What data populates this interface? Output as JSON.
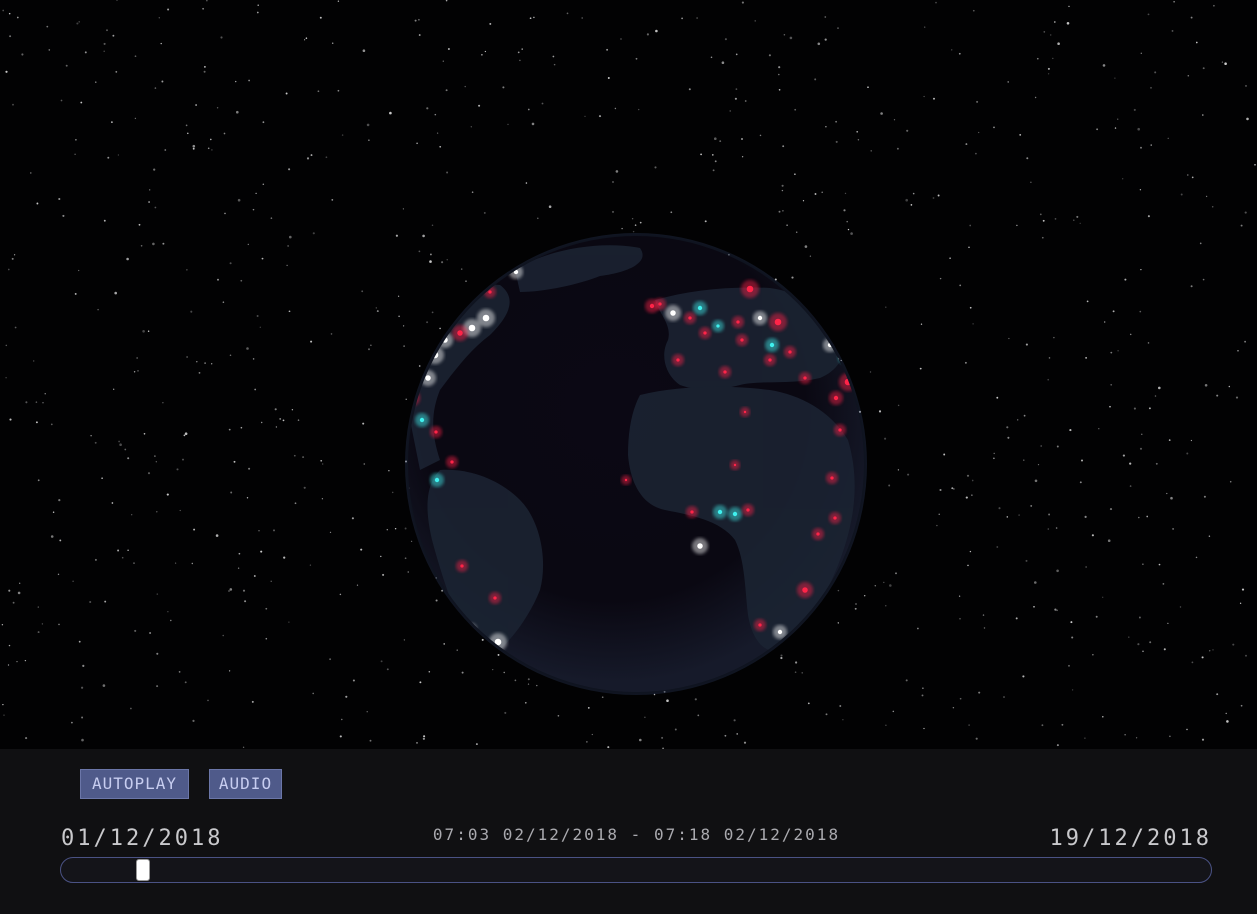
{
  "controls": {
    "autoplay_label": "AUTOPLAY",
    "audio_label": "AUDIO"
  },
  "timeline": {
    "start_date": "01/12/2018",
    "end_date": "19/12/2018",
    "current_range": "07:03 02/12/2018 - 07:18 02/12/2018",
    "position_fraction": 0.066
  },
  "colors": {
    "background": "#020203",
    "panel": "#101012",
    "button": "#4f5a8a",
    "marker_red": "#ff2448",
    "marker_cyan": "#3ff0ee",
    "marker_white": "#ffffff"
  }
}
